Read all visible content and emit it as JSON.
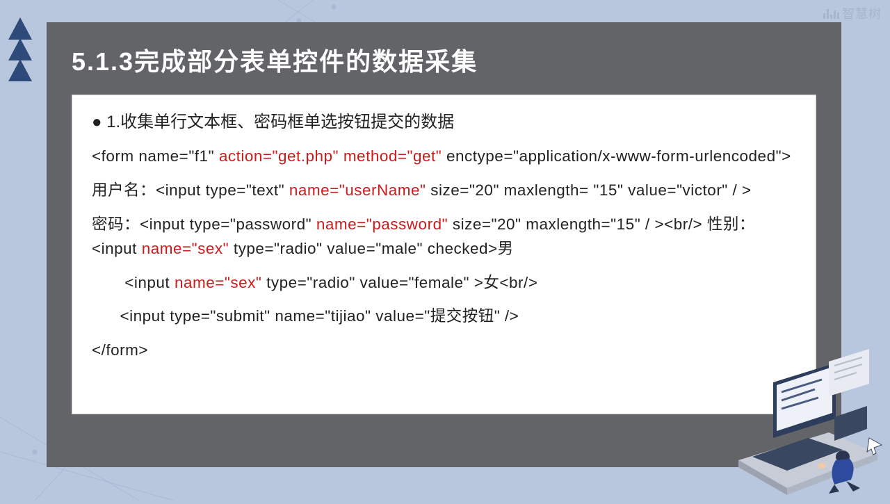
{
  "watermark": "智慧树",
  "slide": {
    "title": "5.1.3完成部分表单控件的数据采集",
    "bullet": "● 1.收集单行文本框、密码框单选按钮提交的数据"
  },
  "code": {
    "line1": {
      "pre": "<form name=\"f1\" ",
      "hl1": "action=\"get.php\"",
      "mid1": "   ",
      "hl2": "method=\"get\"",
      "post": "   enctype=\"application/x-www-form-urlencoded\">"
    },
    "line2": {
      "pre": "用户名：<input type=\"text\" ",
      "hl": "name=\"userName\"",
      "post": "  size=\"20\"  maxlength= \"15\" value=\"victor\" / >"
    },
    "line3": {
      "pre": "密码：<input type=\"password\" ",
      "hl": "name=\"password\"",
      "mid": "  size=\"20\"  maxlength=\"15\"  / ><br/>   性别：<input ",
      "hl2": "name=\"sex\"",
      "post": " type=\"radio\" value=\"male\" checked>男"
    },
    "line4": {
      "pre": "       <input ",
      "hl": "name=\"sex\"",
      "post": " type=\"radio\" value=\"female\" >女<br/>"
    },
    "line5": "      <input type=\"submit\" name=\"tijiao\" value=\"提交按钮\" />",
    "line6": "</form>"
  }
}
